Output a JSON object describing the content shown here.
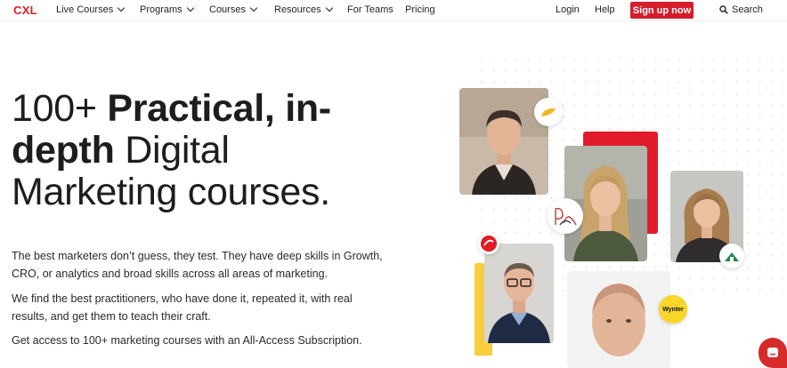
{
  "nav": {
    "logo": "CXL",
    "items": [
      {
        "label": "Live Courses",
        "dropdown": true
      },
      {
        "label": "Programs",
        "dropdown": true
      },
      {
        "label": "Courses",
        "dropdown": true
      },
      {
        "label": "Resources",
        "dropdown": true
      },
      {
        "label": "For Teams",
        "dropdown": false
      },
      {
        "label": "Pricing",
        "dropdown": false
      }
    ],
    "login": "Login",
    "help": "Help",
    "signup": "Sign up now",
    "search": "Search"
  },
  "hero": {
    "headline_part1": "100+ ",
    "headline_bold": "Practical, in-depth",
    "headline_part2": " Digital Marketing courses.",
    "paragraphs": [
      "The best marketers don’t guess, they test. They have deep skills in Growth, CRO, or analytics and broad skills across all areas of marketing.",
      "We find the best practitioners, who have done it, repeated it, with real results, and get them to teach their craft.",
      "Get access to 100+ marketing courses with an All-Access Subscription."
    ]
  },
  "badges": {
    "wynter": "Wynter"
  },
  "colors": {
    "brand_red": "#d41e2b",
    "accent_yellow": "#f7cd3b"
  },
  "icons": [
    "chevron-down-icon",
    "search-icon",
    "chat-icon"
  ]
}
